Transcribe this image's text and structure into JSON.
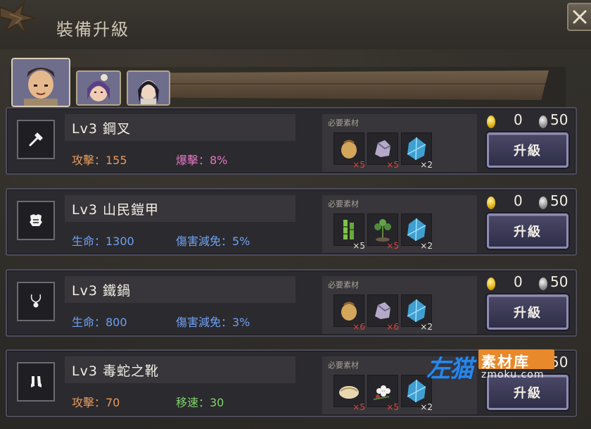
{
  "window": {
    "title": "裝備升級"
  },
  "characters": [
    {
      "name": "character-1",
      "active": true
    },
    {
      "name": "character-2",
      "active": false
    },
    {
      "name": "character-3",
      "active": false
    }
  ],
  "materials_label": "必要素材",
  "upgrade_label": "升級",
  "equipment": [
    {
      "name": "Lv3 鋼叉",
      "icon": "fork-weapon-icon",
      "stat1": "攻擊：155",
      "stat2": "爆擊：8%",
      "gold": "0",
      "silver": "50",
      "materials": [
        {
          "icon": "ore-sack-icon",
          "count": "×5",
          "color": "red"
        },
        {
          "icon": "crystal-ore-icon",
          "count": "×5",
          "color": "red"
        },
        {
          "icon": "blue-gem-icon",
          "count": "×2",
          "color": "white"
        }
      ]
    },
    {
      "name": "Lv3 山民鎧甲",
      "icon": "armor-icon",
      "stat1": "生命：1300",
      "stat2": "傷害減免：5%",
      "gold": "0",
      "silver": "50",
      "materials": [
        {
          "icon": "bamboo-icon",
          "count": "×5",
          "color": "white"
        },
        {
          "icon": "herb-plant-icon",
          "count": "×5",
          "color": "red"
        },
        {
          "icon": "blue-gem-icon",
          "count": "×2",
          "color": "white"
        }
      ]
    },
    {
      "name": "Lv3 鐵鍋",
      "icon": "necklace-icon",
      "stat1": "生命：800",
      "stat2": "傷害減免：3%",
      "gold": "0",
      "silver": "50",
      "materials": [
        {
          "icon": "ore-sack-icon",
          "count": "×6",
          "color": "red"
        },
        {
          "icon": "crystal-ore-icon",
          "count": "×6",
          "color": "red"
        },
        {
          "icon": "blue-gem-icon",
          "count": "×2",
          "color": "white"
        }
      ]
    },
    {
      "name": "Lv3 毒蛇之靴",
      "icon": "boots-icon",
      "stat1": "攻擊：70",
      "stat2": "移速：30",
      "gold": "",
      "silver": "50",
      "materials": [
        {
          "icon": "fabric-roll-icon",
          "count": "×5",
          "color": "red"
        },
        {
          "icon": "flower-icon",
          "count": "×5",
          "color": "red"
        },
        {
          "icon": "blue-gem-icon",
          "count": "×2",
          "color": "white"
        }
      ]
    }
  ],
  "watermark": {
    "brand": "左猫",
    "sub": "素材库",
    "url": "zmoku.com"
  }
}
